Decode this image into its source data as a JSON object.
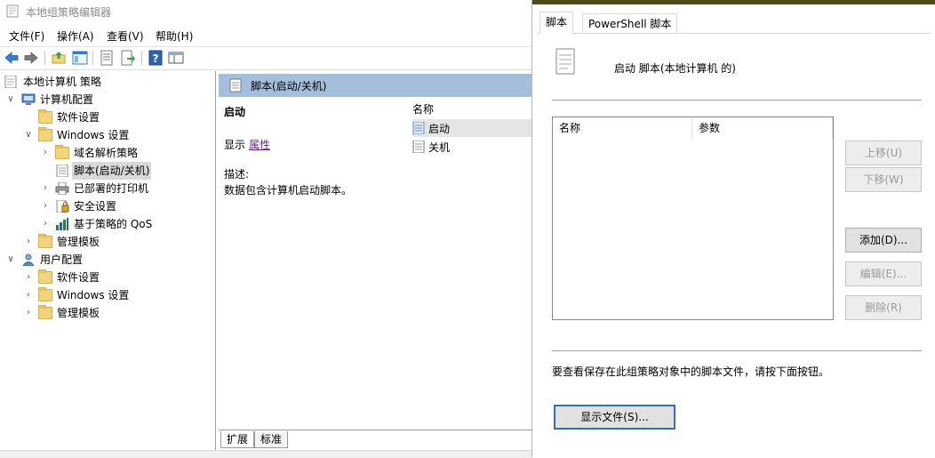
{
  "window": {
    "title": "本地组策略编辑器"
  },
  "menu": [
    "文件(F)",
    "操作(A)",
    "查看(V)",
    "帮助(H)"
  ],
  "tree": {
    "root": "本地计算机 策略",
    "items": [
      {
        "label": "计算机配置",
        "level": 1,
        "chevron": "down",
        "icon": "computer-icon"
      },
      {
        "label": "软件设置",
        "level": 2,
        "chevron": "",
        "icon": "folder-icon"
      },
      {
        "label": "Windows 设置",
        "level": 2,
        "chevron": "down",
        "icon": "folder-icon"
      },
      {
        "label": "域名解析策略",
        "level": 3,
        "chevron": "right",
        "icon": "folder-icon"
      },
      {
        "label": "脚本(启动/关机)",
        "level": 3,
        "chevron": "",
        "icon": "script-icon",
        "selected": true
      },
      {
        "label": "已部署的打印机",
        "level": 3,
        "chevron": "right",
        "icon": "printer-icon"
      },
      {
        "label": "安全设置",
        "level": 3,
        "chevron": "right",
        "icon": "security-icon"
      },
      {
        "label": "基于策略的 QoS",
        "level": 3,
        "chevron": "right",
        "icon": "qos-chart-icon"
      },
      {
        "label": "管理模板",
        "level": 2,
        "chevron": "right",
        "icon": "folder-icon"
      },
      {
        "label": "用户配置",
        "level": 1,
        "chevron": "down",
        "icon": "user-icon"
      },
      {
        "label": "软件设置",
        "level": 2,
        "chevron": "right",
        "icon": "folder-icon"
      },
      {
        "label": "Windows 设置",
        "level": 2,
        "chevron": "right",
        "icon": "folder-icon"
      },
      {
        "label": "管理模板",
        "level": 2,
        "chevron": "right",
        "icon": "folder-icon"
      }
    ]
  },
  "middle": {
    "header": "脚本(启动/关机)",
    "section_title": "启动",
    "display_label": "显示",
    "properties_link": "属性",
    "description_label": "描述:",
    "description_text": "数据包含计算机启动脚本。",
    "list_header": "名称",
    "list_items": [
      "启动",
      "关机"
    ],
    "tabs": [
      "扩展",
      "标准"
    ]
  },
  "dialog": {
    "tabs": [
      "脚本",
      "PowerShell 脚本"
    ],
    "active_tab": 0,
    "heading": "启动 脚本(本地计算机 的)",
    "columns": [
      "名称",
      "参数"
    ],
    "buttons": {
      "up": "上移(U)",
      "down": "下移(W)",
      "add": "添加(D)...",
      "edit": "编辑(E)...",
      "remove": "删除(R)"
    },
    "hint": "要查看保存在此组策略对象中的脚本文件，请按下面按钮。",
    "show_files": "显示文件(S)..."
  },
  "colors": {
    "mid_header_bg": "#a4bedc",
    "link": "#6b1fa3",
    "dialog_topbar": "#4d4a1b",
    "default_button_border": "#2c6fc7"
  }
}
